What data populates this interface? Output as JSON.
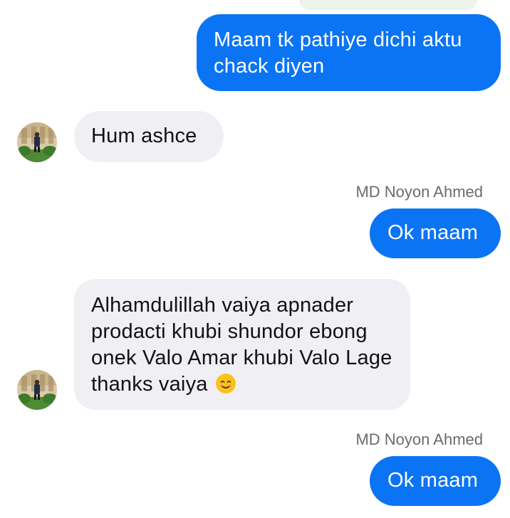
{
  "conversation": {
    "messages": [
      {
        "direction": "outgoing",
        "text": "Maam tk pathiye dichi aktu chack diyen"
      },
      {
        "direction": "incoming",
        "text": "Hum ashce"
      },
      {
        "direction": "outgoing",
        "sender": "MD Noyon Ahmed",
        "text": "Ok maam"
      },
      {
        "direction": "incoming",
        "text": "Alhamdulillah vaiya apnader prodacti khubi shundor ebong onek Valo Amar khubi Valo Lage thanks vaiya",
        "emoji": "smiling-face-emoji"
      },
      {
        "direction": "outgoing",
        "sender": "MD Noyon Ahmed",
        "text": "Ok maam"
      }
    ]
  },
  "colors": {
    "outgoing_bubble": "#0a74f5",
    "incoming_bubble": "#f0f0f4",
    "sender_name": "#6b6b6b"
  }
}
